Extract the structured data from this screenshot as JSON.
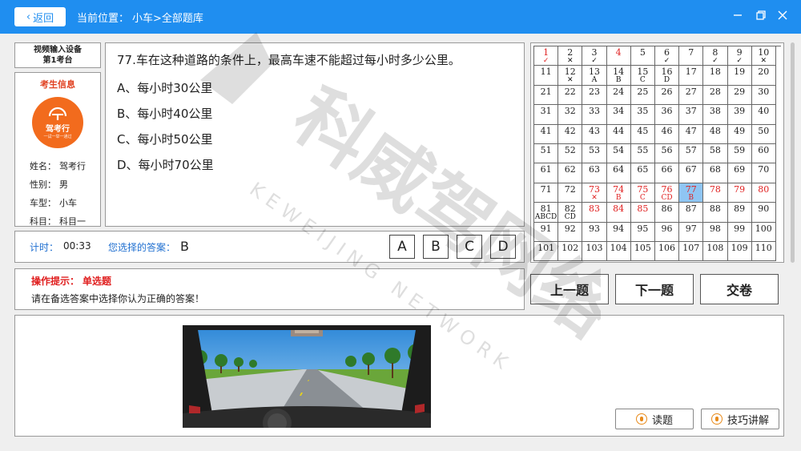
{
  "topbar": {
    "back_label": "返回",
    "location_label": "当前位置：",
    "location_path": "小车>全部题库"
  },
  "device": {
    "line1": "视频输入设备",
    "line2": "第1考台"
  },
  "examinee": {
    "header": "考生信息",
    "logo_text": "驾考行",
    "logo_sub": "一试一举一通过",
    "rows": [
      {
        "key": "姓名：",
        "value": "驾考行"
      },
      {
        "key": "性别：",
        "value": "男"
      },
      {
        "key": "车型：",
        "value": "小车"
      },
      {
        "key": "科目：",
        "value": "科目一"
      }
    ]
  },
  "question": {
    "title": "77.车在这种道路的条件上，最高车速不能超过每小时多少公里。",
    "options": [
      "A、每小时30公里",
      "B、每小时40公里",
      "C、每小时50公里",
      "D、每小时70公里"
    ]
  },
  "answer_strip": {
    "timer_label": "计时：",
    "timer_value": "00:33",
    "chosen_label": "您选择的答案：",
    "chosen_value": "B",
    "buttons": [
      "A",
      "B",
      "C",
      "D"
    ]
  },
  "grid": {
    "cells": [
      {
        "n": "1",
        "m": "✓",
        "red": true,
        "mc": "ok"
      },
      {
        "n": "2",
        "m": "✕"
      },
      {
        "n": "3",
        "m": "✓"
      },
      {
        "n": "4",
        "red": true
      },
      {
        "n": "5"
      },
      {
        "n": "6",
        "m": "✓"
      },
      {
        "n": "7"
      },
      {
        "n": "8",
        "m": "✓"
      },
      {
        "n": "9",
        "m": "✓"
      },
      {
        "n": "10",
        "m": "✕"
      },
      {
        "n": "11"
      },
      {
        "n": "12",
        "m": "✕"
      },
      {
        "n": "13",
        "m": "A"
      },
      {
        "n": "14",
        "m": "B"
      },
      {
        "n": "15",
        "m": "C"
      },
      {
        "n": "16",
        "m": "D"
      },
      {
        "n": "17"
      },
      {
        "n": "18"
      },
      {
        "n": "19"
      },
      {
        "n": "20"
      },
      {
        "n": "21"
      },
      {
        "n": "22"
      },
      {
        "n": "23"
      },
      {
        "n": "24"
      },
      {
        "n": "25"
      },
      {
        "n": "26"
      },
      {
        "n": "27"
      },
      {
        "n": "28"
      },
      {
        "n": "29"
      },
      {
        "n": "30"
      },
      {
        "n": "31"
      },
      {
        "n": "32"
      },
      {
        "n": "33"
      },
      {
        "n": "34"
      },
      {
        "n": "35"
      },
      {
        "n": "36"
      },
      {
        "n": "37"
      },
      {
        "n": "38"
      },
      {
        "n": "39"
      },
      {
        "n": "40"
      },
      {
        "n": "41"
      },
      {
        "n": "42"
      },
      {
        "n": "43"
      },
      {
        "n": "44"
      },
      {
        "n": "45"
      },
      {
        "n": "46"
      },
      {
        "n": "47"
      },
      {
        "n": "48"
      },
      {
        "n": "49"
      },
      {
        "n": "50"
      },
      {
        "n": "51"
      },
      {
        "n": "52"
      },
      {
        "n": "53"
      },
      {
        "n": "54"
      },
      {
        "n": "55"
      },
      {
        "n": "56"
      },
      {
        "n": "57"
      },
      {
        "n": "58"
      },
      {
        "n": "59"
      },
      {
        "n": "60"
      },
      {
        "n": "61"
      },
      {
        "n": "62"
      },
      {
        "n": "63"
      },
      {
        "n": "64"
      },
      {
        "n": "65"
      },
      {
        "n": "66"
      },
      {
        "n": "67"
      },
      {
        "n": "68"
      },
      {
        "n": "69"
      },
      {
        "n": "70"
      },
      {
        "n": "71"
      },
      {
        "n": "72"
      },
      {
        "n": "73",
        "m": "✕",
        "red": true
      },
      {
        "n": "74",
        "m": "B",
        "red": true
      },
      {
        "n": "75",
        "m": "C",
        "red": true
      },
      {
        "n": "76",
        "m": "CD",
        "red": true
      },
      {
        "n": "77",
        "m": "B",
        "red": true,
        "cur": true
      },
      {
        "n": "78",
        "red": true
      },
      {
        "n": "79",
        "red": true
      },
      {
        "n": "80",
        "red": true
      },
      {
        "n": "81",
        "m": "ABCD"
      },
      {
        "n": "82",
        "m": "CD"
      },
      {
        "n": "83",
        "red": true
      },
      {
        "n": "84",
        "red": true
      },
      {
        "n": "85",
        "red": true
      },
      {
        "n": "86"
      },
      {
        "n": "87"
      },
      {
        "n": "88"
      },
      {
        "n": "89"
      },
      {
        "n": "90"
      },
      {
        "n": "91"
      },
      {
        "n": "92"
      },
      {
        "n": "93"
      },
      {
        "n": "94"
      },
      {
        "n": "95"
      },
      {
        "n": "96"
      },
      {
        "n": "97"
      },
      {
        "n": "98"
      },
      {
        "n": "99"
      },
      {
        "n": "100"
      },
      {
        "n": "101"
      },
      {
        "n": "102"
      },
      {
        "n": "103"
      },
      {
        "n": "104"
      },
      {
        "n": "105"
      },
      {
        "n": "106"
      },
      {
        "n": "107"
      },
      {
        "n": "108"
      },
      {
        "n": "109"
      },
      {
        "n": "110"
      }
    ]
  },
  "hint": {
    "label": "操作提示：",
    "type": "单选题",
    "text": "请在备选答案中选择你认为正确的答案！"
  },
  "nav": {
    "prev": "上一题",
    "next": "下一题",
    "submit": "交卷"
  },
  "tools": {
    "read": "读题",
    "tips": "技巧讲解"
  },
  "watermark": {
    "cn": "科威驾网络",
    "en": "KEWEIJING NETWORK"
  },
  "colors": {
    "brand": "#1f8ef0",
    "accent_red": "#e02020",
    "current_cell": "#8fc5f3",
    "logo": "#f26b1d"
  },
  "icons": {
    "back": "chevron-left-icon",
    "minimize": "minimize-icon",
    "restore": "restore-icon",
    "close": "close-icon",
    "audio": "microphone-icon"
  }
}
